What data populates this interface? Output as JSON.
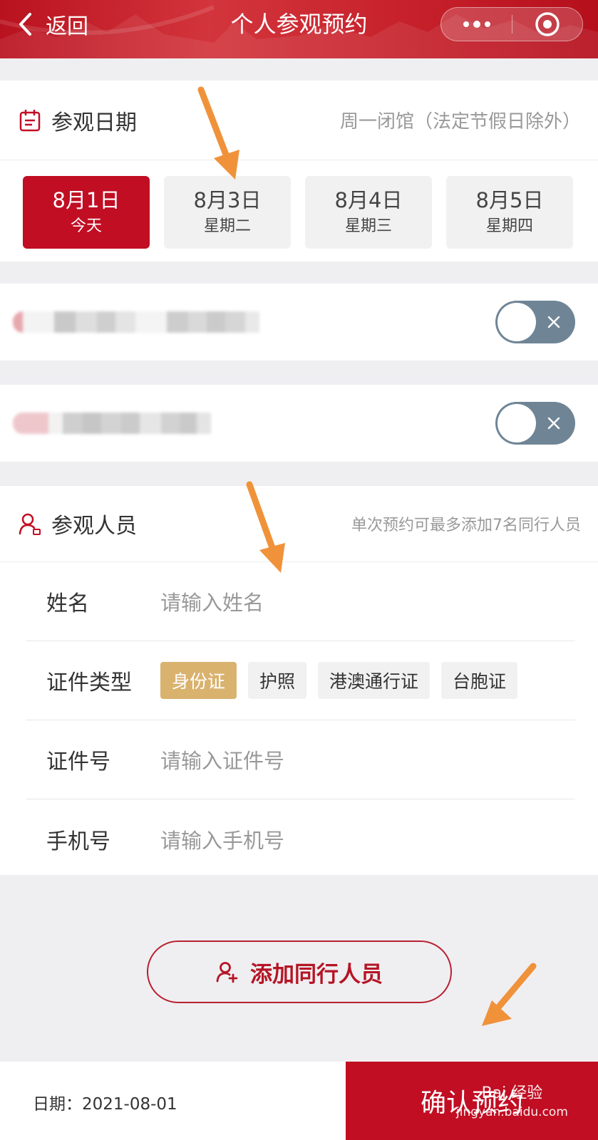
{
  "header": {
    "back_label": "返回",
    "title": "个人参观预约"
  },
  "visit_date": {
    "title": "参观日期",
    "hint": "周一闭馆（法定节假日除外）",
    "options": [
      {
        "date": "8月1日",
        "weekday": "今天",
        "selected": true
      },
      {
        "date": "8月3日",
        "weekday": "星期二",
        "selected": false
      },
      {
        "date": "8月4日",
        "weekday": "星期三",
        "selected": false
      },
      {
        "date": "8月5日",
        "weekday": "星期四",
        "selected": false
      }
    ]
  },
  "toggles": [
    {
      "state": "off"
    },
    {
      "state": "off"
    }
  ],
  "visitors": {
    "title": "参观人员",
    "hint": "单次预约可最多添加7名同行人员",
    "name_label": "姓名",
    "name_placeholder": "请输入姓名",
    "id_type_label": "证件类型",
    "id_types": [
      "身份证",
      "护照",
      "港澳通行证",
      "台胞证"
    ],
    "id_type_selected": "身份证",
    "id_number_label": "证件号",
    "id_number_placeholder": "请输入证件号",
    "phone_label": "手机号",
    "phone_placeholder": "请输入手机号"
  },
  "add_companion_label": "添加同行人员",
  "footer": {
    "date_text": "日期：2021-08-01",
    "confirm_label": "确认预约"
  },
  "watermark": {
    "brand": "Bai 经验",
    "url": "jingyan.baidu.com"
  },
  "colors": {
    "primary": "#c10e23",
    "chip_selected": "#d9b26e",
    "switch_off": "#6f8596",
    "annotation_arrow": "#f0923a"
  }
}
